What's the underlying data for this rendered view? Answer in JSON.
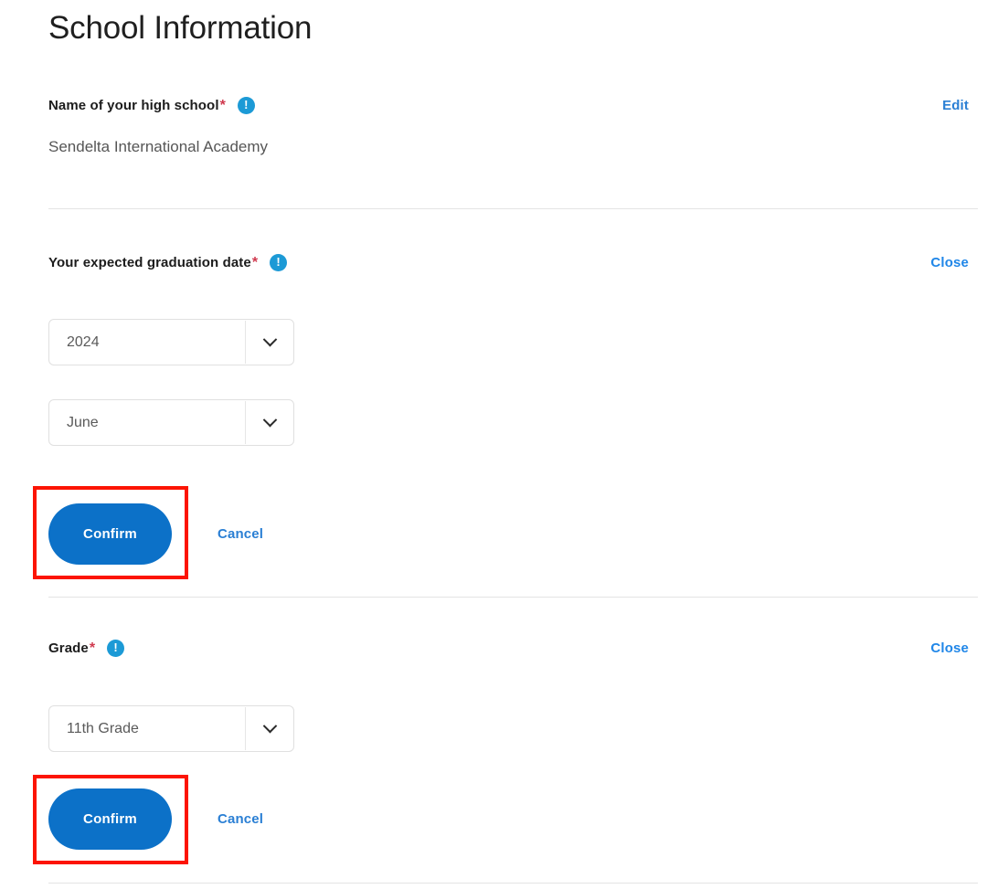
{
  "header": {
    "title": "School Information"
  },
  "icons": {
    "info": "info-exclamation-icon",
    "chevron": "chevron-down-icon"
  },
  "colors": {
    "accent_blue": "#0c71c8",
    "link_blue": "#2a7fd4",
    "info_icon_blue": "#1c9ad6",
    "required_star_red": "#d0394e",
    "annotation_red": "#fc1403",
    "divider_gray": "#e4e4e4",
    "input_border_gray": "#e0e0e0",
    "value_text_gray": "#565656"
  },
  "sections": [
    {
      "id": "school-name",
      "label": "Name of your high school",
      "required_marker": "*",
      "info_icon_char": "!",
      "action_label": "Edit",
      "value": "Sendelta International Academy",
      "state": "collapsed"
    },
    {
      "id": "graduation-date",
      "label": "Your expected graduation date",
      "required_marker": "*",
      "info_icon_char": "!",
      "action_label": "Close",
      "state": "expanded",
      "fields": [
        {
          "name": "graduation-year",
          "value": "2024"
        },
        {
          "name": "graduation-month",
          "value": "June"
        }
      ],
      "buttons": {
        "confirm_label": "Confirm",
        "cancel_label": "Cancel"
      }
    },
    {
      "id": "grade",
      "label": "Grade",
      "required_marker": "*",
      "info_icon_char": "!",
      "action_label": "Close",
      "state": "expanded",
      "fields": [
        {
          "name": "grade-select",
          "value": "11th Grade"
        }
      ],
      "buttons": {
        "confirm_label": "Confirm",
        "cancel_label": "Cancel"
      }
    }
  ],
  "annotations": [
    {
      "name": "highlight-confirm-graduation",
      "target": "graduation-confirm-button"
    },
    {
      "name": "highlight-confirm-grade",
      "target": "grade-confirm-button"
    }
  ]
}
